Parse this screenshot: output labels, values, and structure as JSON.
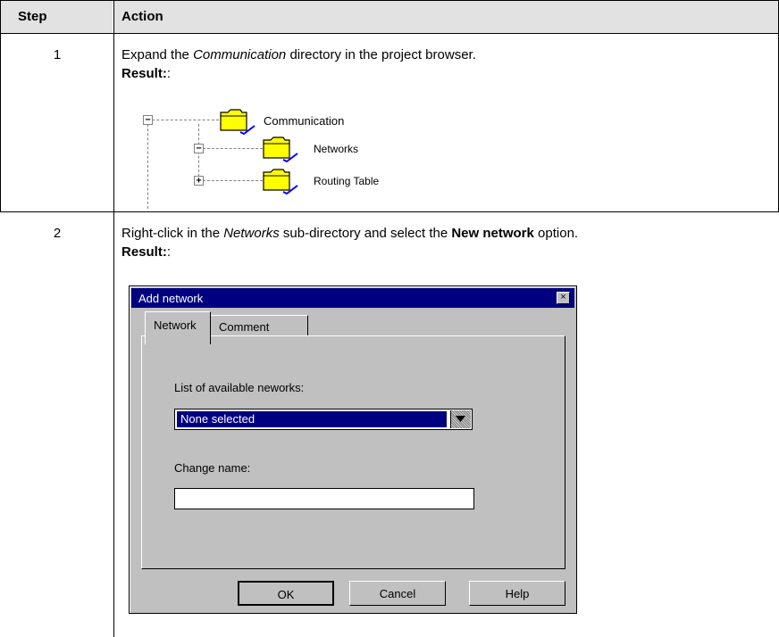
{
  "header": {
    "step": "Step",
    "action": "Action"
  },
  "step1": {
    "number": "1",
    "text_before": "Expand the ",
    "text_italic": "Communication",
    "text_after": " directory in the project browser.",
    "result_label": "Result:",
    "result_colon": ":",
    "tree": {
      "root": "Communication",
      "children": [
        "Networks",
        "Routing Table"
      ]
    }
  },
  "step2": {
    "number": "2",
    "text_before": "Right-click in the ",
    "text_italic": "Networks",
    "text_middle": " sub-directory and select the ",
    "text_bold": "New network",
    "text_after": " option.",
    "result_label": "Result:",
    "result_colon": ":"
  },
  "dialog": {
    "title": "Add network",
    "close_glyph": "×",
    "tabs": [
      "Network",
      "Comment"
    ],
    "list_label": "List of available neworks:",
    "list_selected": "None selected",
    "name_label": "Change name:",
    "name_value": "",
    "buttons": {
      "ok": "OK",
      "cancel": "Cancel",
      "help": "Help"
    }
  },
  "colors": {
    "header_bg": "#e2e2e2",
    "dialog_bg": "#c0c0c0",
    "titlebar": "#000080",
    "folder": "#ffff00",
    "checkmark": "#0000ff"
  },
  "icons": {
    "folder": "folder-icon",
    "check": "checkmark-icon",
    "expand": "plus-box-icon",
    "collapse": "minus-box-icon",
    "dropdown": "dropdown-arrow-icon",
    "close": "close-icon"
  }
}
